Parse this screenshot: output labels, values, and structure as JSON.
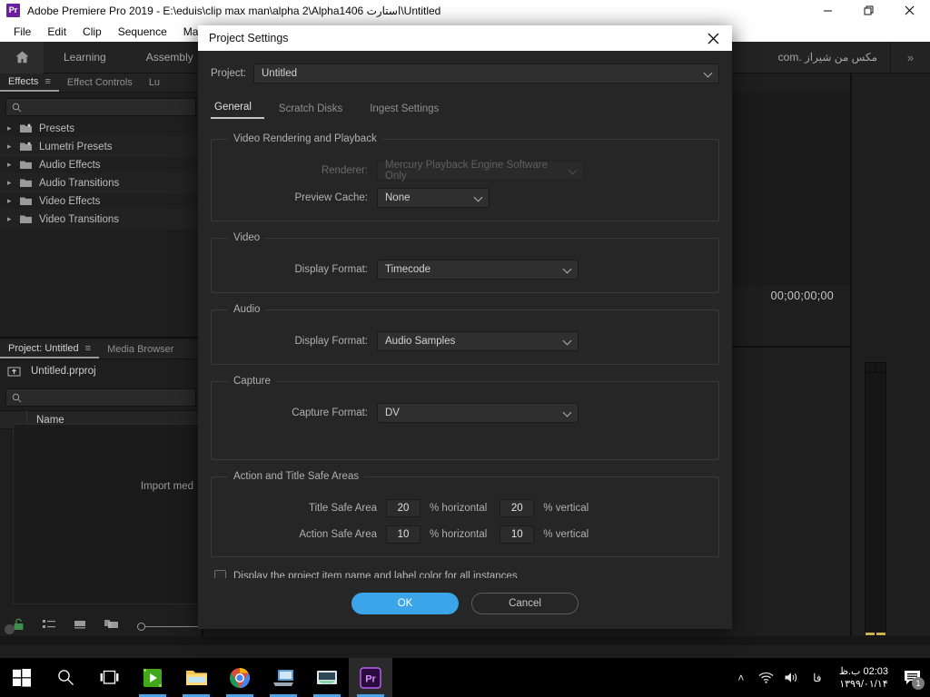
{
  "window": {
    "app_badge": "Pr",
    "title": "Adobe Premiere Pro 2019 - E:\\eduis\\clip max man\\alpha 2\\Alpha1406 استارت\\Untitled",
    "minimize": "–",
    "restore": "❐",
    "close": "✕"
  },
  "menubar": {
    "items": [
      "File",
      "Edit",
      "Clip",
      "Sequence",
      "Markers"
    ]
  },
  "workspace": {
    "home_icon": "home-icon",
    "tabs": [
      "Learning",
      "Assembly"
    ],
    "watermark": "مكس من شيراز .com",
    "overflow": "»"
  },
  "effects_panel": {
    "tabs": [
      {
        "label": "Effects",
        "active": true
      },
      {
        "label": "Effect Controls",
        "active": false
      },
      {
        "label": "Lu",
        "active": false
      }
    ],
    "menu_icon": "≡",
    "search_placeholder": "",
    "search_value": "",
    "items": [
      {
        "label": "Presets",
        "type": "preset-folder"
      },
      {
        "label": "Lumetri Presets",
        "type": "preset-folder"
      },
      {
        "label": "Audio Effects",
        "type": "folder"
      },
      {
        "label": "Audio Transitions",
        "type": "folder"
      },
      {
        "label": "Video Effects",
        "type": "folder"
      },
      {
        "label": "Video Transitions",
        "type": "folder"
      }
    ]
  },
  "project_panel": {
    "tabs": [
      {
        "label": "Project: Untitled",
        "active": true
      },
      {
        "label": "Media Browser",
        "active": false
      }
    ],
    "menu_icon": "≡",
    "project_file": "Untitled.prproj",
    "search_value": "",
    "columns": [
      "Name"
    ],
    "import_hint": "Import med",
    "tools": [
      "lock-icon",
      "list-view-icon",
      "icon-view-icon",
      "freeform-view-icon",
      "zoom-slider"
    ]
  },
  "monitor_panel": {
    "timecode": "00;00;00;00",
    "tools": [
      "mark-in-icon",
      "mark-out-icon",
      "insert-icon",
      "overwrite-icon",
      "overflow-icon",
      "add-button-icon"
    ]
  },
  "dialog": {
    "title": "Project Settings",
    "close": "✕",
    "project_label": "Project:",
    "project_value": "Untitled",
    "tabs": [
      {
        "label": "General",
        "active": true
      },
      {
        "label": "Scratch Disks",
        "active": false
      },
      {
        "label": "Ingest Settings",
        "active": false
      }
    ],
    "sections": {
      "video_rendering": {
        "legend": "Video Rendering and Playback",
        "renderer_label": "Renderer:",
        "renderer_value": "Mercury Playback Engine Software Only",
        "renderer_disabled": true,
        "preview_cache_label": "Preview Cache:",
        "preview_cache_value": "None"
      },
      "video": {
        "legend": "Video",
        "display_format_label": "Display Format:",
        "display_format_value": "Timecode"
      },
      "audio": {
        "legend": "Audio",
        "display_format_label": "Display Format:",
        "display_format_value": "Audio Samples"
      },
      "capture": {
        "legend": "Capture",
        "capture_format_label": "Capture Format:",
        "capture_format_value": "DV"
      },
      "safe_areas": {
        "legend": "Action and Title Safe Areas",
        "title_safe_label": "Title Safe Area",
        "title_safe_h": "20",
        "title_safe_v": "20",
        "action_safe_label": "Action Safe Area",
        "action_safe_h": "10",
        "action_safe_v": "10",
        "unit_horizontal": "% horizontal",
        "unit_vertical": "% vertical"
      }
    },
    "checkbox_label": "Display the project item name and label color for all instances",
    "checkbox_checked": false,
    "ok_label": "OK",
    "cancel_label": "Cancel",
    "accent_color": "#3aa5e8"
  },
  "taskbar": {
    "apps": [
      "start-icon",
      "search-icon",
      "task-view-icon",
      "media-app-icon",
      "file-explorer-icon",
      "chrome-icon",
      "app-icon-7",
      "app-icon-8",
      "premiere-icon"
    ],
    "tray": {
      "overflow": "˄",
      "network_icon": "wifi-icon",
      "volume_icon": "volume-icon",
      "language": "فا",
      "time": "02:03 ب.ظ",
      "date": "۱۳۹۹/۰۱/۱۴",
      "notification_count": "1"
    }
  }
}
